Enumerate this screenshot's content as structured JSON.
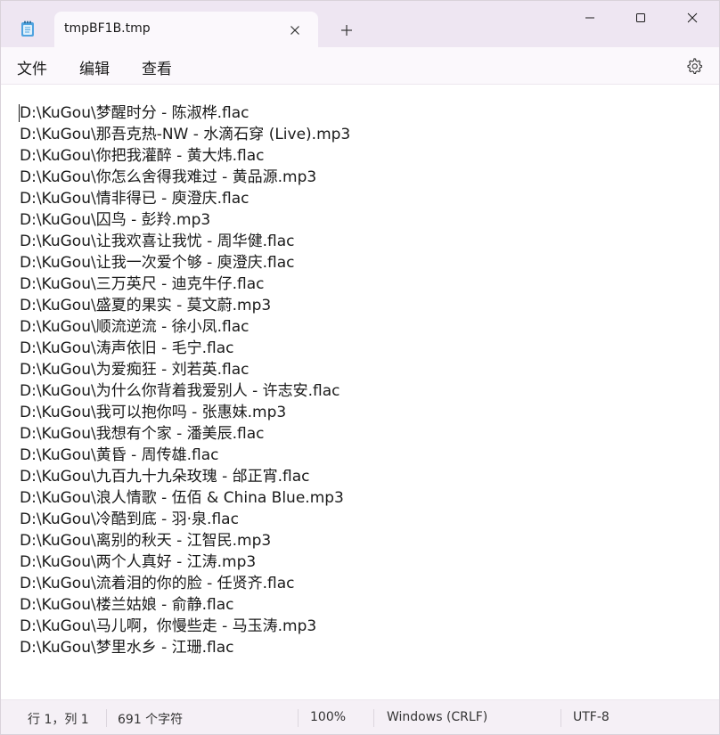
{
  "colors": {
    "titlebar_bg": "#eee6f2",
    "menubar_bg": "#fbf8fc",
    "statusbar_bg": "#f5f0f6",
    "text": "#1a1a1a"
  },
  "icons": {
    "app": "notepad-icon",
    "tab_close": "close-icon",
    "new_tab": "plus-icon",
    "minimize": "minimize-icon",
    "maximize": "maximize-icon",
    "close": "close-icon",
    "settings": "gear-icon"
  },
  "tab": {
    "title": "tmpBF1B.tmp"
  },
  "menu": {
    "file": "文件",
    "edit": "编辑",
    "view": "查看"
  },
  "editor": {
    "lines": [
      "D:\\KuGou\\梦醒时分 - 陈淑桦.flac",
      "D:\\KuGou\\那吾克热-NW - 水滴石穿 (Live).mp3",
      "D:\\KuGou\\你把我灌醉 - 黄大炜.flac",
      "D:\\KuGou\\你怎么舍得我难过 - 黄品源.mp3",
      "D:\\KuGou\\情非得已 - 庾澄庆.flac",
      "D:\\KuGou\\囚鸟 - 彭羚.mp3",
      "D:\\KuGou\\让我欢喜让我忧 - 周华健.flac",
      "D:\\KuGou\\让我一次爱个够 - 庾澄庆.flac",
      "D:\\KuGou\\三万英尺 - 迪克牛仔.flac",
      "D:\\KuGou\\盛夏的果实 - 莫文蔚.mp3",
      "D:\\KuGou\\顺流逆流 - 徐小凤.flac",
      "D:\\KuGou\\涛声依旧 - 毛宁.flac",
      "D:\\KuGou\\为爱痴狂 - 刘若英.flac",
      "D:\\KuGou\\为什么你背着我爱别人 - 许志安.flac",
      "D:\\KuGou\\我可以抱你吗 - 张惠妹.mp3",
      "D:\\KuGou\\我想有个家 - 潘美辰.flac",
      "D:\\KuGou\\黄昏 - 周传雄.flac",
      "D:\\KuGou\\九百九十九朵玫瑰 - 邰正宵.flac",
      "D:\\KuGou\\浪人情歌 - 伍佰 & China Blue.mp3",
      "D:\\KuGou\\冷酷到底 - 羽·泉.flac",
      "D:\\KuGou\\离别的秋天 - 江智民.mp3",
      "D:\\KuGou\\两个人真好 - 江涛.mp3",
      "D:\\KuGou\\流着泪的你的脸 - 任贤齐.flac",
      "D:\\KuGou\\楼兰姑娘 - 俞静.flac",
      "D:\\KuGou\\马儿啊，你慢些走 - 马玉涛.mp3",
      "D:\\KuGou\\梦里水乡 - 江珊.flac"
    ]
  },
  "status": {
    "position": "行 1，列 1",
    "char_count": "691 个字符",
    "zoom": "100%",
    "line_ending": "Windows (CRLF)",
    "encoding": "UTF-8"
  }
}
